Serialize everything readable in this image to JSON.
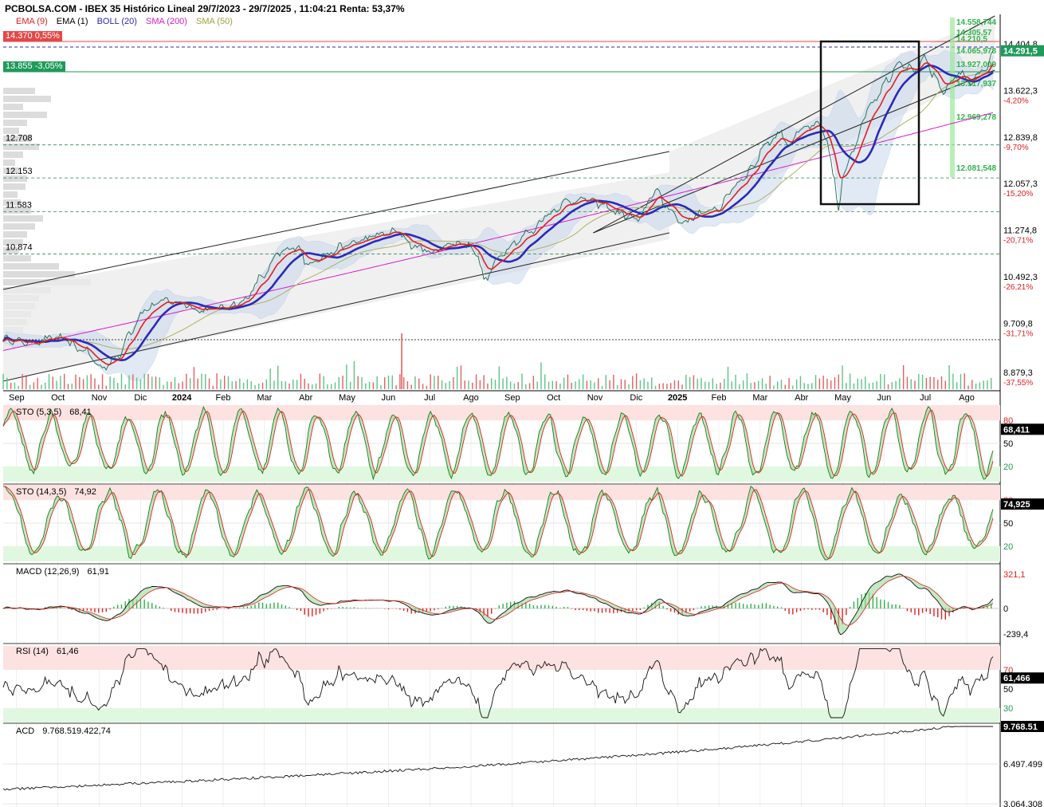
{
  "header": {
    "title": "PCBOLSA.COM - IBEX 35 Histórico Lineal 29/7/2023 - 29/7/2025 , 11:04:21 Renta: 53,37%"
  },
  "legend": [
    {
      "name": "EMA (9)",
      "color": "#e02020"
    },
    {
      "name": "EMA (1)",
      "color": "#000000"
    },
    {
      "name": "BOLL (20)",
      "color": "#2a2ab8"
    },
    {
      "name": "SMA (200)",
      "color": "#d81bc8"
    },
    {
      "name": "SMA (50)",
      "color": "#a0a040"
    }
  ],
  "price_badges": [
    {
      "text": "14.370  0,55%",
      "color": "#e44848",
      "value": 14370
    },
    {
      "text": "13.855  -3,05%",
      "color": "#1e9a5a",
      "value": 13855
    }
  ],
  "chart_data": {
    "type": "line",
    "price_axis": {
      "ticks": [
        {
          "value": 14404.8,
          "label": "14.404,8",
          "pct": ""
        },
        {
          "value": 13622.3,
          "label": "13.622,3",
          "pct": "-4,20%"
        },
        {
          "value": 12839.8,
          "label": "12.839,8",
          "pct": "-9,70%"
        },
        {
          "value": 12057.3,
          "label": "12.057,3",
          "pct": "-15,20%"
        },
        {
          "value": 11274.8,
          "label": "11.274,8",
          "pct": "-20,71%"
        },
        {
          "value": 10492.3,
          "label": "10.492,3",
          "pct": "-26,21%"
        },
        {
          "value": 9709.8,
          "label": "9.709,8",
          "pct": "-31,71%"
        },
        {
          "value": 8879.3,
          "label": "8.879,3",
          "pct": "-37,55%"
        }
      ],
      "last_price_badge": "14.291,5"
    },
    "levels": [
      {
        "value": 12708,
        "label": "12.708"
      },
      {
        "value": 12153,
        "label": "12.153"
      },
      {
        "value": 11583,
        "label": "11.583"
      },
      {
        "value": 10874,
        "label": "10.874"
      }
    ],
    "fib_labels": [
      "14.558,744",
      "14.305,57",
      "14.210,5",
      "14.065,978",
      "13.927,009",
      "13.517,937",
      "12.969,278",
      "12.081,548"
    ],
    "x_months": [
      "Sep",
      "Oct",
      "Nov",
      "Dic",
      "2024",
      "Feb",
      "Mar",
      "Abr",
      "May",
      "Jun",
      "Jul",
      "Ago",
      "Sep",
      "Oct",
      "Nov",
      "Dic",
      "2025",
      "Feb",
      "Mar",
      "Abr",
      "May",
      "Jun",
      "Jul",
      "Ago"
    ],
    "close_anchors": [
      [
        0,
        9440
      ],
      [
        3,
        9380
      ],
      [
        6,
        9470
      ],
      [
        9,
        9260
      ],
      [
        11,
        8960
      ],
      [
        13,
        9150
      ],
      [
        14,
        9550
      ],
      [
        16,
        9950
      ],
      [
        18,
        10090
      ],
      [
        20,
        10050
      ],
      [
        22,
        9920
      ],
      [
        24,
        9960
      ],
      [
        26,
        10020
      ],
      [
        27,
        10100
      ],
      [
        29,
        10500
      ],
      [
        31,
        10900
      ],
      [
        33,
        11000
      ],
      [
        34,
        10700
      ],
      [
        36,
        10850
      ],
      [
        38,
        11000
      ],
      [
        40,
        11100
      ],
      [
        42,
        11200
      ],
      [
        44,
        11250
      ],
      [
        46,
        11000
      ],
      [
        48,
        10900
      ],
      [
        50,
        11050
      ],
      [
        52,
        11050
      ],
      [
        53,
        10850
      ],
      [
        54,
        10400
      ],
      [
        55,
        10750
      ],
      [
        57,
        11050
      ],
      [
        59,
        11250
      ],
      [
        61,
        11550
      ],
      [
        63,
        11750
      ],
      [
        65,
        11800
      ],
      [
        67,
        11700
      ],
      [
        69,
        11550
      ],
      [
        71,
        11450
      ],
      [
        73,
        11950
      ],
      [
        74,
        11700
      ],
      [
        76,
        11400
      ],
      [
        78,
        11550
      ],
      [
        80,
        11650
      ],
      [
        82,
        12050
      ],
      [
        84,
        12350
      ],
      [
        85,
        12700
      ],
      [
        87,
        12900
      ],
      [
        88,
        12700
      ],
      [
        89,
        12950
      ],
      [
        91,
        13050
      ],
      [
        92,
        12850
      ],
      [
        93,
        12100
      ],
      [
        93.4,
        11600
      ],
      [
        94,
        12200
      ],
      [
        95,
        12650
      ],
      [
        97,
        13400
      ],
      [
        99,
        13800
      ],
      [
        100,
        14100
      ],
      [
        101,
        14050
      ],
      [
        102,
        13950
      ],
      [
        103,
        14150
      ],
      [
        104,
        13900
      ],
      [
        105,
        13600
      ],
      [
        106,
        13750
      ],
      [
        107,
        13950
      ],
      [
        108,
        13750
      ],
      [
        109,
        13900
      ],
      [
        110,
        14000
      ],
      [
        110.7,
        14291
      ]
    ],
    "sto_5_3_5": {
      "label": "STO (5,3,5)",
      "value": "68,41",
      "badge": "68,411",
      "levels": [
        80,
        50,
        20
      ]
    },
    "sto_14_3_5": {
      "label": "STO (14,3,5)",
      "value": "74,92",
      "badge": "74,925",
      "levels": [
        80,
        50,
        20
      ]
    },
    "macd": {
      "label": "MACD (12,26,9)",
      "value": "61,91",
      "ticks": [
        "321,1",
        "0",
        "-239,4"
      ]
    },
    "rsi": {
      "label": "RSI (14)",
      "value": "61,46",
      "badge": "61,466",
      "levels": [
        70,
        50,
        30
      ]
    },
    "acd": {
      "label": "ACD",
      "value": "9.768.519.422,74",
      "badge": "9.768.51",
      "ticks": [
        "6.497.499",
        "3.064.308"
      ]
    }
  }
}
